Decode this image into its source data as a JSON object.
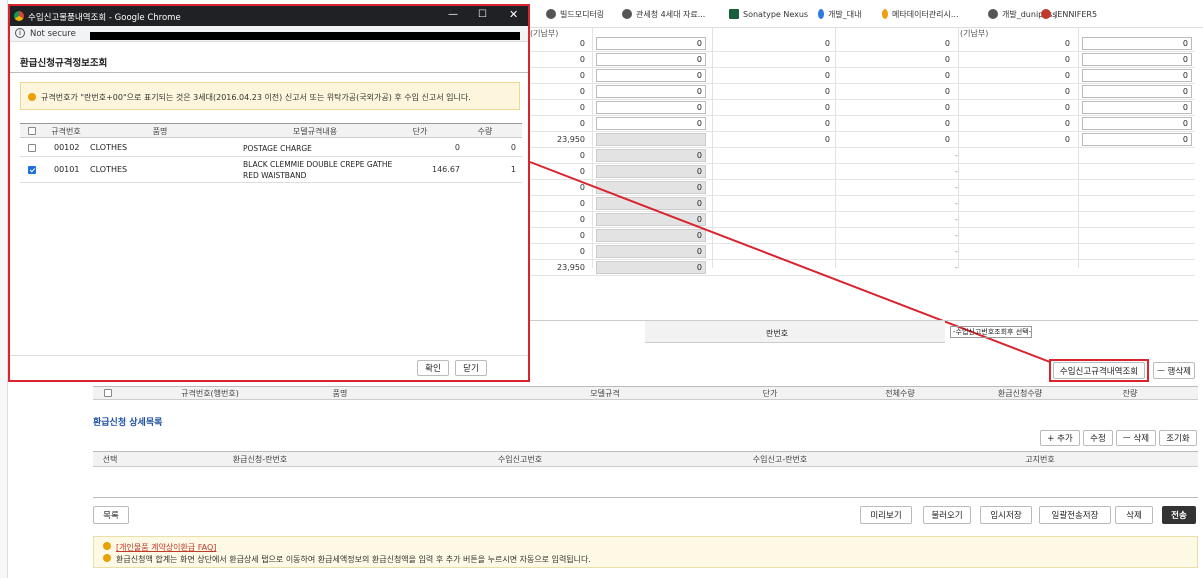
{
  "browser": {
    "bookmarks": [
      "빌드모디터링",
      "관세청 4세대 자료...",
      "Sonatype Nexus",
      "개발_대내",
      "메타데이터관리시...",
      "개발_dunipass",
      "JENNIFER5"
    ]
  },
  "main": {
    "top_headers": [
      "(기납부)",
      "(기납부)"
    ],
    "rows_a": [
      {
        "v1": "0",
        "v2": "0",
        "v3": "0",
        "v4": "0",
        "v5": "0",
        "v6": "0"
      },
      {
        "v1": "0",
        "v2": "0",
        "v3": "0",
        "v4": "0",
        "v5": "0",
        "v6": "0"
      },
      {
        "v1": "0",
        "v2": "0",
        "v3": "0",
        "v4": "0",
        "v5": "0",
        "v6": "0"
      },
      {
        "v1": "0",
        "v2": "0",
        "v3": "0",
        "v4": "0",
        "v5": "0",
        "v6": "0"
      },
      {
        "v1": "0",
        "v2": "0",
        "v3": "0",
        "v4": "0",
        "v5": "0",
        "v6": "0"
      },
      {
        "v1": "0",
        "v2": "0",
        "v3": "0",
        "v4": "0",
        "v5": "0",
        "v6": "0"
      },
      {
        "v1": "23,950",
        "v2": "",
        "v3": "0",
        "v4": "0",
        "v5": "0",
        "v6": "0"
      }
    ],
    "rows_b": [
      {
        "v1": "0",
        "v2": "0",
        "dash": "-"
      },
      {
        "v1": "0",
        "v2": "0",
        "dash": "-"
      },
      {
        "v1": "0",
        "v2": "0",
        "dash": "-"
      },
      {
        "v1": "0",
        "v2": "0",
        "dash": "-"
      },
      {
        "v1": "0",
        "v2": "0",
        "dash": "-"
      },
      {
        "v1": "0",
        "v2": "0",
        "dash": "-"
      },
      {
        "v1": "0",
        "v2": "0",
        "dash": "-"
      },
      {
        "v1": "23,950",
        "v2": "0",
        "dash": "-"
      }
    ],
    "lan_label": "란번호",
    "lan_select": "-수입신고번호조회후 선택-",
    "lookup_button": "수입신고규격내역조회",
    "row_delete_button": "ㅡ 행삭제",
    "spec_headers": [
      "규격번호(행번호)",
      "품명",
      "모델규격",
      "단가",
      "전체수량",
      "환급신청수량",
      "잔량"
    ],
    "detail_title": "환급신청 상세목록",
    "detail_buttons": [
      "+ 추가",
      "수정",
      "ㅡ 삭제",
      "조기화"
    ],
    "detail_headers": [
      "선택",
      "환급신청-란번호",
      "수입신고번호",
      "수입신고-란번호",
      "고지번호"
    ],
    "list_button": "목록",
    "action_buttons": [
      "미리보기",
      "불러오기",
      "임시저장",
      "일괄전송저장",
      "삭제",
      "전송"
    ],
    "notice_link": "[개인물품 계약상이환급 FAQ]",
    "notice_text": "환급신청액 합계는 화면 상단에서 환급상세 탭으로 이동하여 환급세액정보의 환급신청액을 입력 후 추가 버튼을 누르시면 자동으로 입력됩니다."
  },
  "popup": {
    "window_title": "수입신고물품내역조회 - Google Chrome",
    "address": "Not secure",
    "title": "환급신청규격정보조회",
    "info": "규격번호가 \"란번호+00\"으로 표기되는 것은 3세대(2016.04.23 이전) 신고서 또는 위탁가공(국외가공) 후 수입 신고서 입니다.",
    "headers": [
      "규격번호",
      "품명",
      "모델규격내용",
      "단가",
      "수량"
    ],
    "rows": [
      {
        "checked": false,
        "code": "00102",
        "name": "CLOTHES",
        "model": "POSTAGE CHARGE",
        "price": "0",
        "qty": "0"
      },
      {
        "checked": true,
        "code": "00101",
        "name": "CLOTHES",
        "model": "BLACK CLEMMIE DOUBLE CREPE GATHE RED WAISTBAND",
        "price": "146.67",
        "qty": "1"
      }
    ],
    "confirm_button": "확인",
    "close_button": "닫기"
  },
  "colors": {
    "highlight": "#d9232e",
    "notice_bg": "#fdf9e4",
    "warning": "#e8a100"
  }
}
